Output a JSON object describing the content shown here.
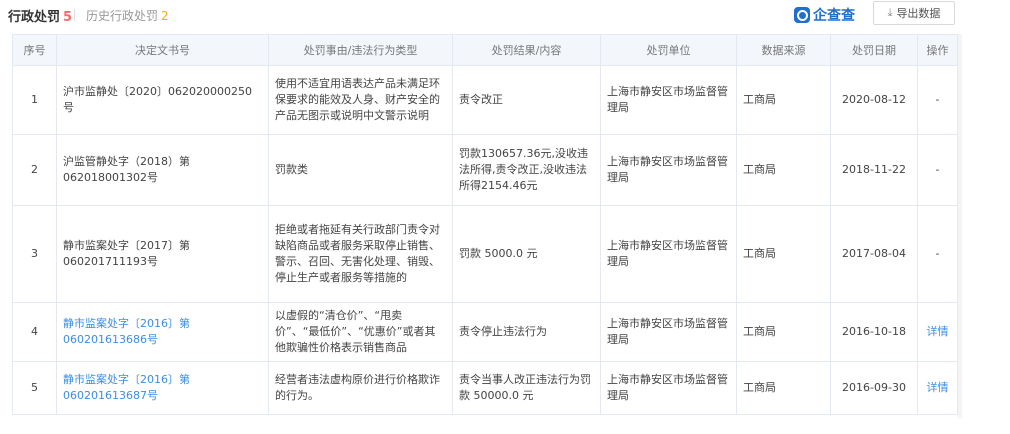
{
  "tabs": {
    "active_label": "行政处罚",
    "active_count": "5",
    "inactive_label": "历史行政处罚",
    "inactive_count": "2"
  },
  "brand": {
    "name": "企查查"
  },
  "export_button": {
    "label": "导出数据",
    "icon": "download-icon"
  },
  "table": {
    "headers": [
      "序号",
      "决定文书号",
      "处罚事由/违法行为类型",
      "处罚结果/内容",
      "处罚单位",
      "数据来源",
      "处罚日期",
      "操作"
    ],
    "rows": [
      {
        "index": "1",
        "doc_no": "沪市监静处〔2020〕062020000250号",
        "reason": "使用不适宜用语表达产品未满足环保要求的能效及人身、财产安全的产品无图示或说明中文警示说明",
        "result": "责令改正",
        "unit": "上海市静安区市场监督管理局",
        "source": "工商局",
        "date": "2020-08-12",
        "action": "-"
      },
      {
        "index": "2",
        "doc_no": "沪监管静处字（2018）第062018001302号",
        "reason": "罚款类",
        "result": "罚款130657.36元,没收违法所得,责令改正,没收违法所得2154.46元",
        "unit": "上海市静安区市场监督管理局",
        "source": "工商局",
        "date": "2018-11-22",
        "action": "-"
      },
      {
        "index": "3",
        "doc_no": "静市监案处字〔2017〕第060201711193号",
        "reason": "拒绝或者拖延有关行政部门责令对缺陷商品或者服务采取停止销售、警示、召回、无害化处理、销毁、停止生产或者服务等措施的",
        "result": "罚款 5000.0 元",
        "unit": "上海市静安区市场监督管理局",
        "source": "工商局",
        "date": "2017-08-04",
        "action": "-"
      },
      {
        "index": "4",
        "doc_no": "静市监案处字〔2016〕第060201613686号",
        "reason": "以虚假的“清仓价”、“甩卖价”、“最低价”、“优惠价”或者其他欺骗性价格表示销售商品",
        "result": "责令停止违法行为",
        "unit": "上海市静安区市场监督管理局",
        "source": "工商局",
        "date": "2016-10-18",
        "action": "详情"
      },
      {
        "index": "5",
        "doc_no": "静市监案处字〔2016〕第060201613687号",
        "reason": "经营者违法虚构原价进行价格欺诈的行为。",
        "result": "责令当事人改正违法行为罚款 50000.0 元",
        "unit": "上海市静安区市场监督管理局",
        "source": "工商局",
        "date": "2016-09-30",
        "action": "详情"
      }
    ]
  }
}
